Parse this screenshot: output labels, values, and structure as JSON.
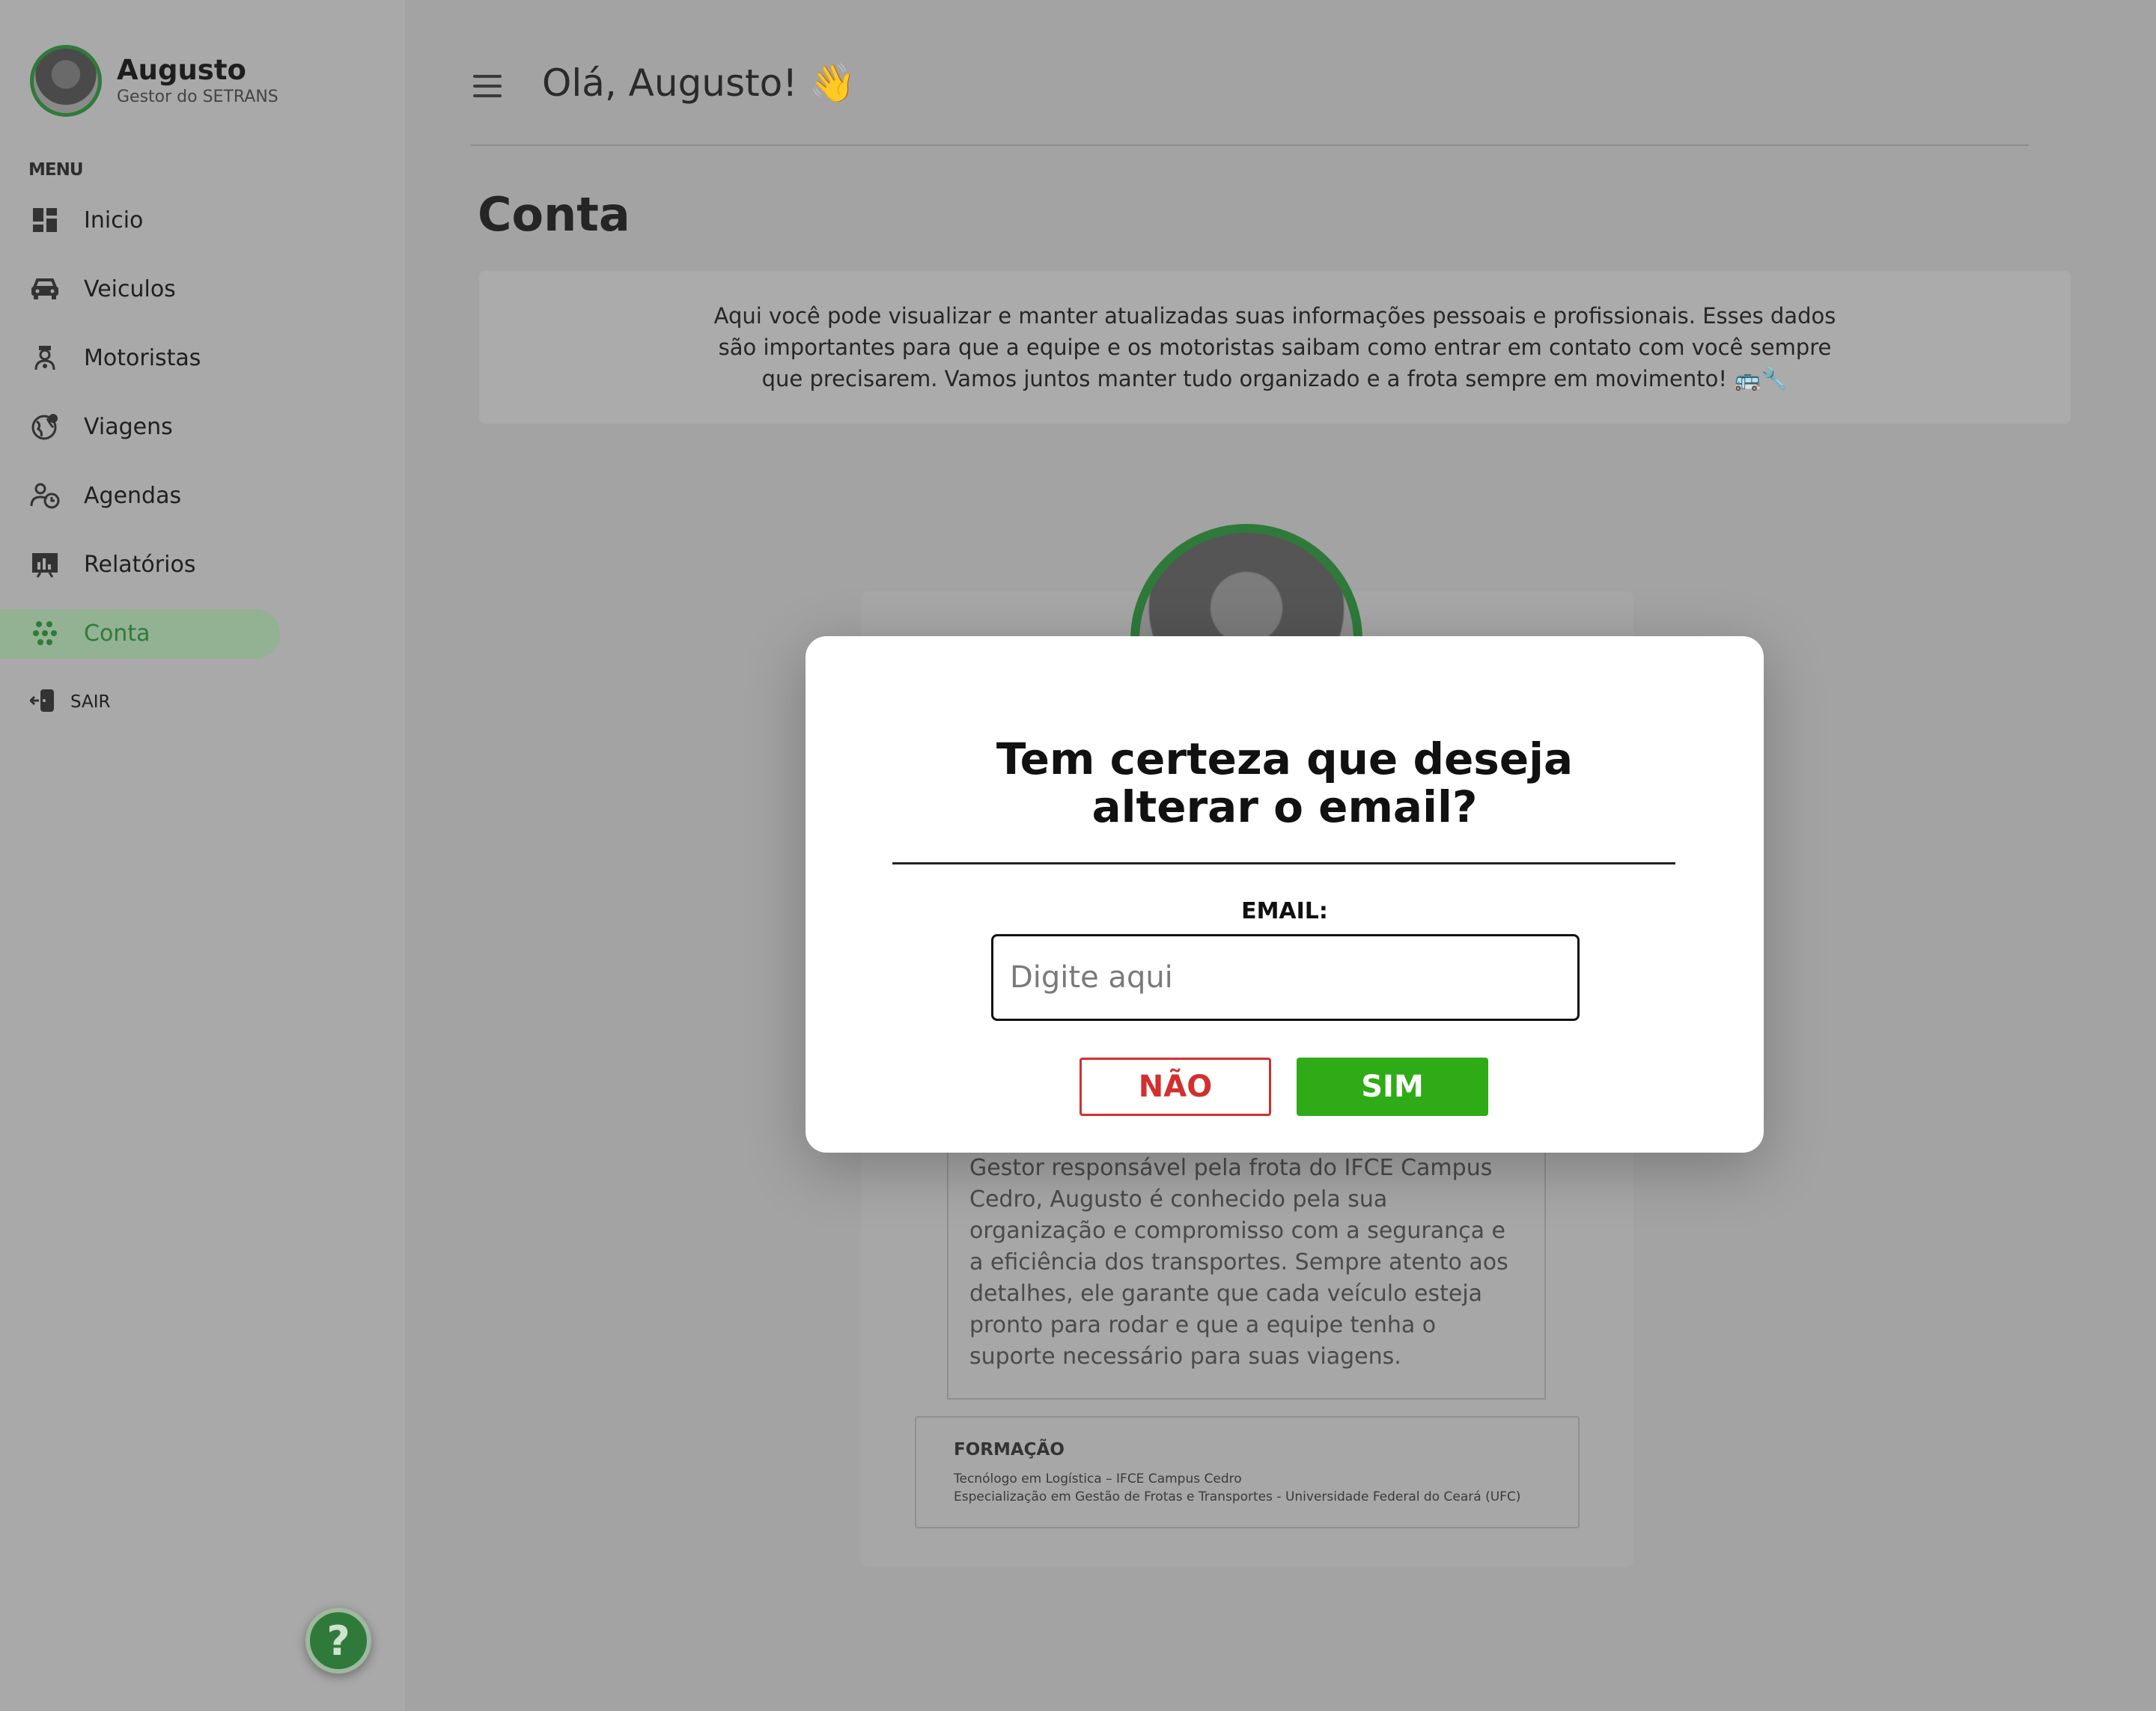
{
  "sidebar": {
    "user_name": "Augusto",
    "user_role": "Gestor do SETRANS",
    "menu_title": "MENU",
    "items": [
      {
        "label": "Inicio",
        "icon": "dashboard-icon"
      },
      {
        "label": "Veiculos",
        "icon": "car-icon"
      },
      {
        "label": "Motoristas",
        "icon": "driver-icon"
      },
      {
        "label": "Viagens",
        "icon": "globe-icon"
      },
      {
        "label": "Agendas",
        "icon": "schedule-icon"
      },
      {
        "label": "Relatórios",
        "icon": "report-icon"
      },
      {
        "label": "Conta",
        "icon": "account-icon",
        "active": true
      }
    ],
    "logout_label": "SAIR",
    "help_label": "?"
  },
  "header": {
    "greeting": "Olá, Augusto! 👋"
  },
  "page": {
    "title": "Conta",
    "info_text": "Aqui você pode visualizar e manter atualizadas suas informações pessoais e profissionais. Esses dados são importantes para que a equipe e os motoristas saibam como entrar em contato com você sempre que precisarem. Vamos juntos manter tudo organizado e a frota sempre em movimento! 🚌🔧"
  },
  "card": {
    "bio": "Gestor responsável pela frota do IFCE Campus Cedro, Augusto é conhecido pela sua organização e compromisso com a segurança e a eficiência dos transportes. Sempre atento aos detalhes, ele garante que cada veículo esteja pronto para rodar e que a equipe tenha o suporte necessário para suas viagens.",
    "education_title": "FORMAÇÃO",
    "education": [
      "Tecnólogo em Logística – IFCE Campus Cedro",
      "Especialização em Gestão de Frotas e Transportes - Universidade Federal do Ceará (UFC)"
    ]
  },
  "modal": {
    "title": "Tem certeza que deseja alterar o email?",
    "email_label": "EMAIL:",
    "email_placeholder": "Digite aqui",
    "email_value": "",
    "no_label": "NÃO",
    "yes_label": "SIM"
  },
  "colors": {
    "accent_green": "#2f7a3a",
    "confirm_green": "#2eab16",
    "cancel_red": "#d32f2f",
    "overlay_gray": "#a3a3a3"
  }
}
